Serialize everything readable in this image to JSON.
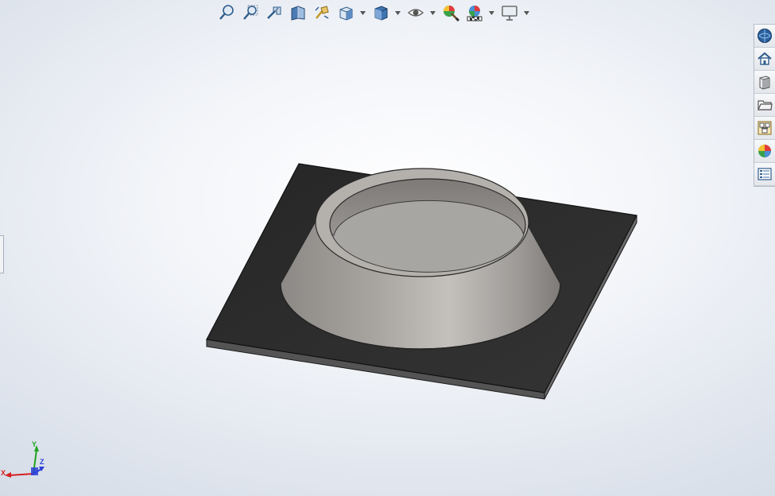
{
  "app": {
    "view": "isometric-part-view"
  },
  "heads_up_toolbar": {
    "tools": [
      {
        "name": "zoom-to-fit-icon",
        "has_menu": false
      },
      {
        "name": "zoom-to-area-icon",
        "has_menu": false
      },
      {
        "name": "previous-view-icon",
        "has_menu": false
      },
      {
        "name": "section-view-icon",
        "has_menu": false
      },
      {
        "name": "dynamic-annotation-views-icon",
        "has_menu": false
      },
      {
        "name": "view-orientation-icon",
        "has_menu": true
      },
      {
        "name": "display-style-icon",
        "has_menu": true
      },
      {
        "name": "hide-show-items-icon",
        "has_menu": true
      },
      {
        "name": "edit-appearance-icon",
        "has_menu": false
      },
      {
        "name": "apply-scene-icon",
        "has_menu": true
      },
      {
        "name": "view-settings-icon",
        "has_menu": true
      }
    ]
  },
  "task_pane": {
    "tabs": [
      {
        "name": "solidworks-resources-icon"
      },
      {
        "name": "home-icon"
      },
      {
        "name": "design-library-icon"
      },
      {
        "name": "file-explorer-icon"
      },
      {
        "name": "view-palette-icon"
      },
      {
        "name": "appearances-scenes-icon"
      },
      {
        "name": "custom-properties-icon"
      }
    ]
  },
  "triad": {
    "x_label": "X",
    "y_label": "Y",
    "z_label": "Z",
    "colors": {
      "x": "#d42020",
      "y": "#1fa31f",
      "z": "#2a3fd8"
    }
  },
  "model_colors": {
    "plate_top": "#2c2c2c",
    "plate_edge": "#5a5a5a",
    "cone": "#9a9794",
    "cone_highlight": "#c9c6c2",
    "inner_wall": "#8f8c89",
    "inner_bottom": "#a7a5a2"
  }
}
